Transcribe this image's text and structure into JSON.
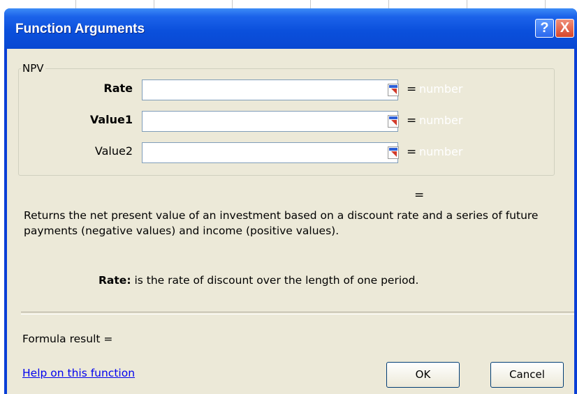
{
  "dialog": {
    "title": "Function Arguments",
    "help_button": "?",
    "close_button": "X"
  },
  "function": {
    "name": "NPV",
    "arguments": [
      {
        "label": "Rate",
        "bold": true,
        "value": "",
        "hint": "number"
      },
      {
        "label": "Value1",
        "bold": true,
        "value": "",
        "hint": "number"
      },
      {
        "label": "Value2",
        "bold": false,
        "value": "",
        "hint": "number"
      }
    ],
    "equals": "=",
    "result_equals": "=",
    "description": "Returns the net present value of an investment based on a discount rate and a series of future payments (negative values) and income (positive values).",
    "argument_help_name": "Rate:",
    "argument_help_text": " is the rate of discount over the length of one period."
  },
  "footer": {
    "formula_result": "Formula result =",
    "help_link": "Help on this function",
    "ok_label": "OK",
    "cancel_label": "Cancel"
  },
  "icons": {
    "collapse": "collapse-dialog-icon",
    "help": "help-icon",
    "close": "close-icon"
  },
  "colors": {
    "titlebar": "#0b50dc",
    "client_background": "#ece9d8",
    "link": "#0000ee",
    "close_button": "#d8452a"
  }
}
